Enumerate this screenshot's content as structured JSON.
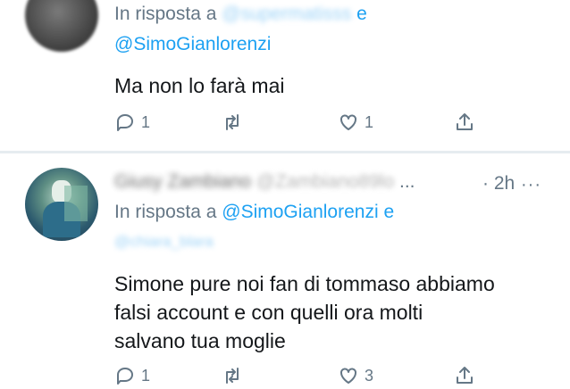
{
  "tweets": [
    {
      "reply_prefix": "In risposta a",
      "reply_user_blurred": "@supermatisss",
      "reply_conj": "e",
      "reply_user2": "@SimoGianlorenzi",
      "text": "Ma non lo farà mai",
      "actions": {
        "reply_count": "1",
        "retweet_count": "",
        "like_count": "1"
      }
    },
    {
      "name_blurred": "Giusy Zambiano",
      "handle_blurred": "@Zambiano89lo",
      "ellipsis": "...",
      "time": "· 2h",
      "more": "···",
      "reply_prefix": "In risposta a",
      "reply_user": "@SimoGianlorenzi",
      "reply_conj": "e",
      "reply_user2_blurred": "@chiara_blara",
      "text_lines": [
        "Simone pure noi fan di tommaso abbiamo",
        "falsi account e con quelli ora molti",
        "salvano tua moglie"
      ],
      "actions": {
        "reply_count": "1",
        "retweet_count": "",
        "like_count": "3"
      }
    }
  ],
  "colors": {
    "accent": "#1da1f2",
    "muted": "#657786",
    "text": "#14171a",
    "divider": "#e6ecf0"
  },
  "icons": [
    "reply-icon",
    "retweet-icon",
    "like-icon",
    "share-icon",
    "more-icon"
  ]
}
